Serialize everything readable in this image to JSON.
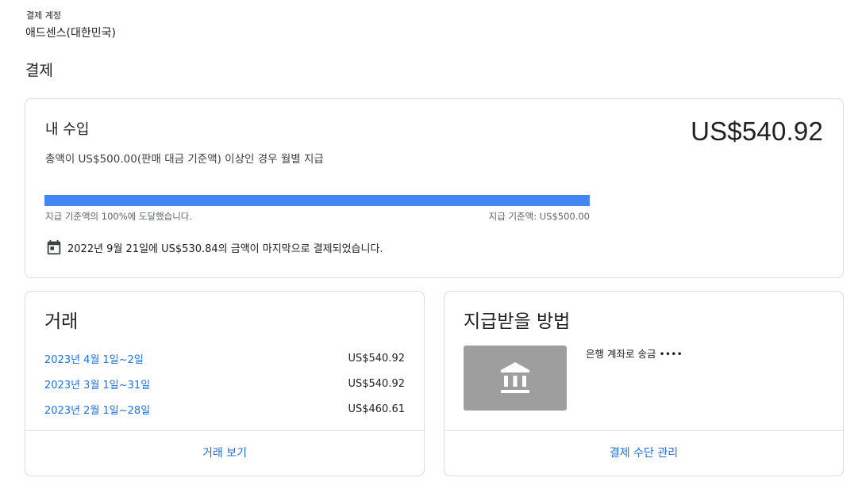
{
  "header": {
    "account_label": "결제 계정",
    "account_name": "애드센스(대한민국)",
    "page_title": "결제"
  },
  "earnings": {
    "title": "내 수입",
    "amount": "US$540.92",
    "subtitle": "총액이 US$500.00(판매 대금 기준액) 이상인 경우 월별 지급",
    "progress_fraction": 1.0,
    "progress_status": "지급 기준액의 100%에 도달했습니다.",
    "threshold_text": "지급 기준액: US$500.00",
    "last_payment": "2022년 9월 21일에 US$530.84의 금액이 마지막으로 결제되었습니다."
  },
  "transactions": {
    "title": "거래",
    "rows": [
      {
        "period": "2023년 4월 1일~2일",
        "amount": "US$540.92"
      },
      {
        "period": "2023년 3월 1일~31일",
        "amount": "US$540.92"
      },
      {
        "period": "2023년 2월 1일~28일",
        "amount": "US$460.61"
      }
    ],
    "view_link": "거래 보기"
  },
  "payment_method": {
    "title": "지급받을 방법",
    "description": "은행 계좌로 송금 ••••",
    "manage_link": "결제 수단 관리"
  },
  "colors": {
    "accent": "#1a73e8",
    "progress": "#4285f4",
    "bank_box": "#9e9e9e"
  },
  "icons": {
    "calendar": "calendar-icon",
    "bank": "bank-icon"
  }
}
